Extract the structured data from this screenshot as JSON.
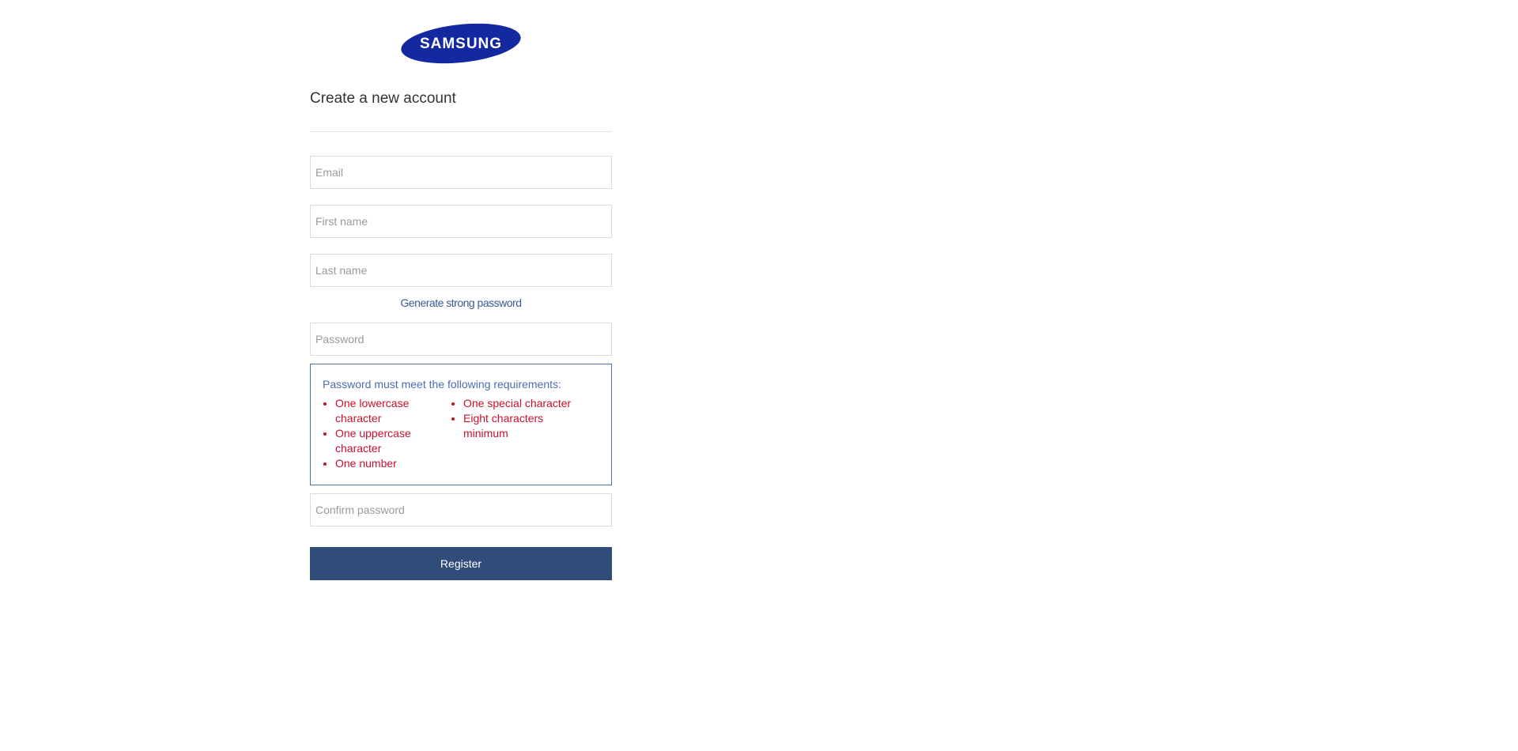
{
  "brand": {
    "logo_text": "SAMSUNG",
    "logo_color": "#1428a0",
    "logo_icon": "samsung-logo"
  },
  "form": {
    "title": "Create a new account",
    "email_placeholder": "Email",
    "first_name_placeholder": "First name",
    "last_name_placeholder": "Last name",
    "generate_link": "Generate strong password",
    "password_placeholder": "Password",
    "confirm_password_placeholder": "Confirm password",
    "register_label": "Register"
  },
  "requirements": {
    "title": "Password must meet the following requirements:",
    "left": [
      "One lowercase character",
      "One uppercase character",
      "One number"
    ],
    "right": [
      "One special character",
      "Eight characters minimum"
    ]
  },
  "colors": {
    "link": "#3b5a96",
    "requirement_unmet": "#c8102e",
    "button_bg": "#304d7a",
    "requirements_border": "#4a6fb0"
  }
}
